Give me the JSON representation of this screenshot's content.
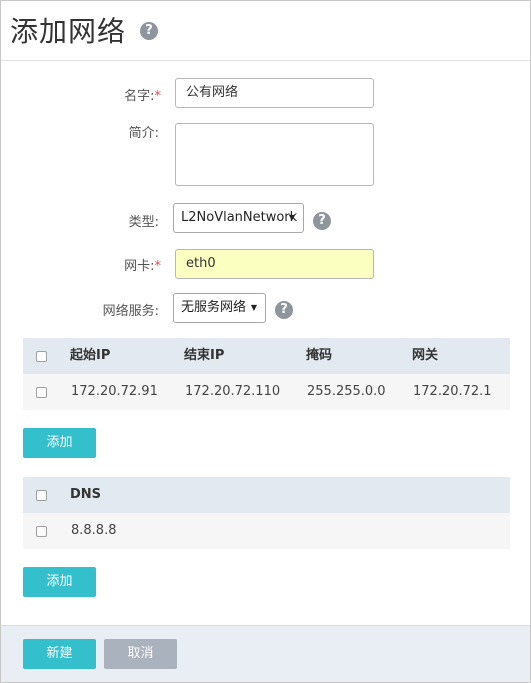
{
  "dialog": {
    "title": "添加网络",
    "help_glyph": "?"
  },
  "form": {
    "name_label": "名字:",
    "name_required": "*",
    "name_value": "公有网络",
    "desc_label": "简介:",
    "desc_value": "",
    "type_label": "类型:",
    "type_value": "L2NoVlanNetwork",
    "nic_label": "网卡:",
    "nic_required": "*",
    "nic_value": "eth0",
    "service_label": "网络服务:",
    "service_value": "无服务网络",
    "caret_glyph": "▼"
  },
  "ip_table": {
    "headers": [
      "起始IP",
      "结束IP",
      "掩码",
      "网关"
    ],
    "rows": [
      [
        "172.20.72.91",
        "172.20.72.110",
        "255.255.0.0",
        "172.20.72.1"
      ]
    ],
    "add_label": "添加"
  },
  "dns_table": {
    "header": "DNS",
    "rows": [
      "8.8.8.8"
    ],
    "add_label": "添加"
  },
  "footer": {
    "create_label": "新建",
    "cancel_label": "取消"
  },
  "colors": {
    "accent": "#33bfcb",
    "cancel": "#a9b2bd",
    "table_header": "#e3e9f1",
    "highlight_input": "#fbffbf",
    "required": "#e34a4a"
  }
}
